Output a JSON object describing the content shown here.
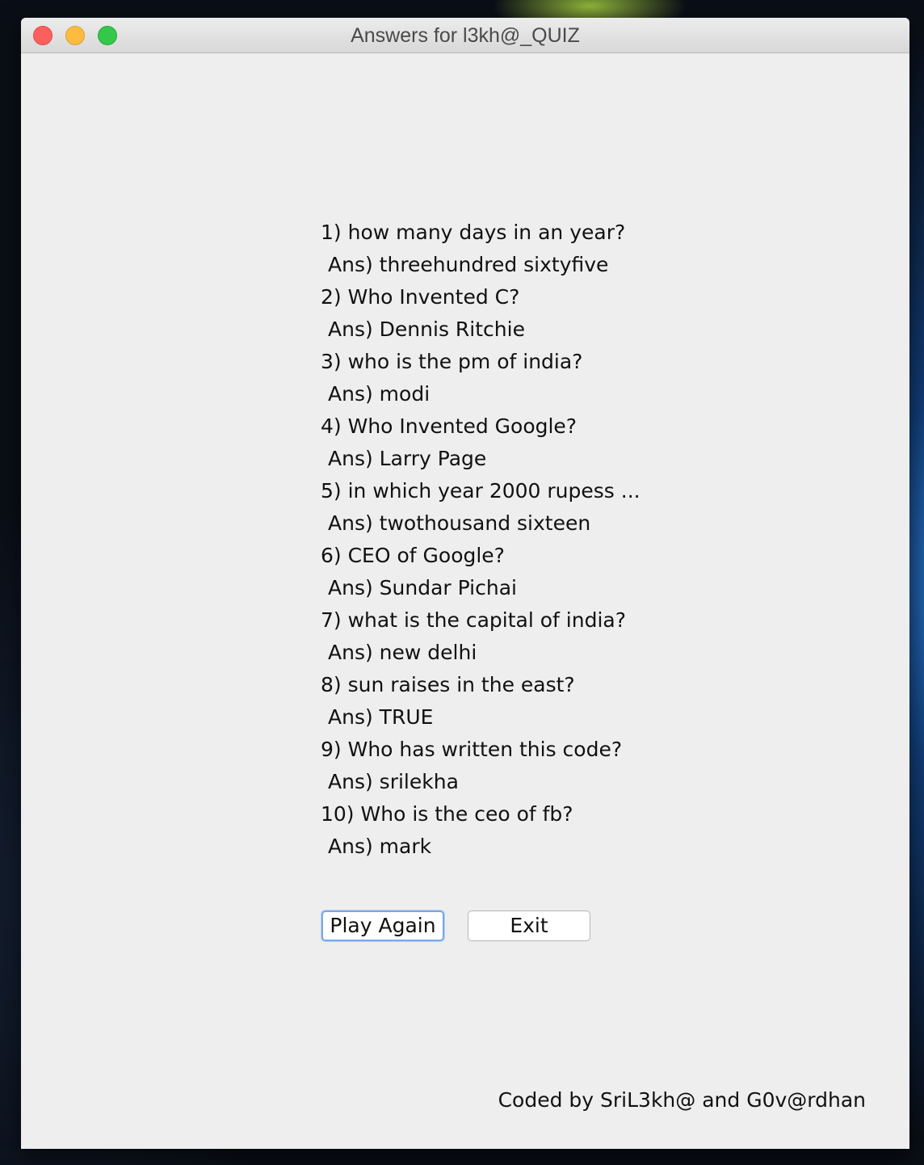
{
  "window": {
    "title": "Answers for l3kh@_QUIZ"
  },
  "qa": [
    {
      "question": "1) how many days in an year?",
      "answer": "Ans) threehundred sixtyfive"
    },
    {
      "question": "2) Who Invented C?",
      "answer": "Ans) Dennis Ritchie"
    },
    {
      "question": "3) who is the pm of india?",
      "answer": "Ans) modi"
    },
    {
      "question": "4) Who Invented Google?",
      "answer": "Ans) Larry Page"
    },
    {
      "question": "5) in which year 2000 rupess ...",
      "answer": "Ans) twothousand sixteen"
    },
    {
      "question": "6) CEO of Google?",
      "answer": "Ans) Sundar Pichai"
    },
    {
      "question": "7) what is the capital of india?",
      "answer": "Ans) new delhi"
    },
    {
      "question": "8) sun raises in the east?",
      "answer": "Ans) TRUE"
    },
    {
      "question": "9) Who has written this code?",
      "answer": "Ans) srilekha"
    },
    {
      "question": "10) Who is the ceo of fb?",
      "answer": "Ans) mark"
    }
  ],
  "buttons": {
    "play_again": "Play Again",
    "exit": "Exit"
  },
  "footer": {
    "credit": "Coded by SriL3kh@ and G0v@rdhan"
  },
  "colors": {
    "close": "#fc605c",
    "minimize": "#fdbc40",
    "maximize": "#34c84a",
    "focus_ring": "#7aa7e6",
    "window_bg": "#eeeeee"
  }
}
